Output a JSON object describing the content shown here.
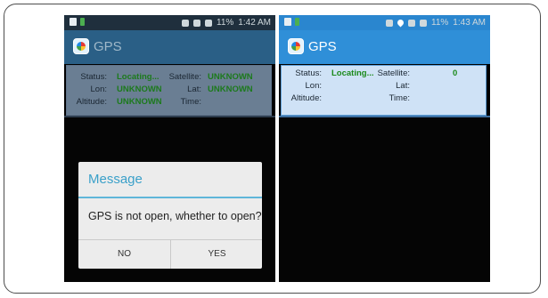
{
  "left_screen": {
    "status_bar": {
      "battery": "11%",
      "time": "1:42 AM"
    },
    "app_bar": {
      "title": "GPS"
    },
    "info": {
      "status_key": "Status:",
      "status_val": "Locating...",
      "satellite_key": "Satellite:",
      "satellite_val": "UNKNOWN",
      "lon_key": "Lon:",
      "lon_val": "UNKNOWN",
      "lat_key": "Lat:",
      "lat_val": "UNKNOWN",
      "altitude_key": "Altitude:",
      "altitude_val": "UNKNOWN",
      "time_key": "Time:",
      "time_val": ""
    },
    "dialog": {
      "title": "Message",
      "message": "GPS is not open, whether to open?",
      "no_label": "NO",
      "yes_label": "YES"
    }
  },
  "right_screen": {
    "status_bar": {
      "battery": "11%",
      "time": "1:43 AM"
    },
    "app_bar": {
      "title": "GPS"
    },
    "info": {
      "status_key": "Status:",
      "status_val": "Locating...",
      "satellite_key": "Satellite:",
      "satellite_val": "0",
      "lon_key": "Lon:",
      "lon_val": "",
      "lat_key": "Lat:",
      "lat_val": "",
      "altitude_key": "Altitude:",
      "altitude_val": "",
      "time_key": "Time:",
      "time_val": ""
    }
  },
  "colors": {
    "left_app_bar": "#2a5f86",
    "right_app_bar": "#2f8fd8",
    "value_green": "#1c7a1c",
    "dialog_accent": "#3aa0c9"
  },
  "icons": [
    "lock-icon",
    "sim-icon",
    "wifi-icon",
    "signal-icon",
    "battery-icon",
    "location-icon",
    "gps-app-icon"
  ]
}
